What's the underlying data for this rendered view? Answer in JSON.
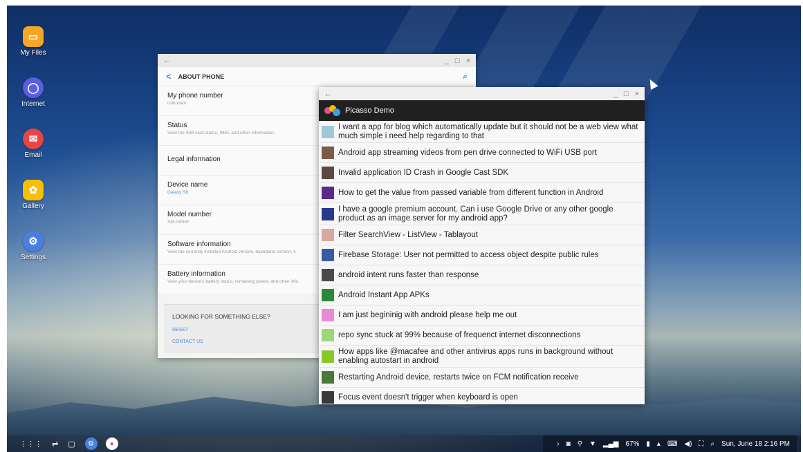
{
  "desktop": {
    "icons": [
      {
        "label": "My Files",
        "icon": "folder-icon",
        "color": "#f5a623",
        "glyph": "▭"
      },
      {
        "label": "Internet",
        "icon": "globe-icon",
        "color": "#5b5ee0",
        "glyph": "◯"
      },
      {
        "label": "Email",
        "icon": "mail-icon",
        "color": "#e84545",
        "glyph": "✉"
      },
      {
        "label": "Gallery",
        "icon": "flower-icon",
        "color": "#f5c000",
        "glyph": "✿"
      },
      {
        "label": "Settings",
        "icon": "gear-icon",
        "color": "#4a7fe0",
        "glyph": "⚙"
      }
    ]
  },
  "about_window": {
    "title_back": "←",
    "controls": [
      "_",
      "□",
      "×"
    ],
    "header": "ABOUT PHONE",
    "items": [
      {
        "title": "My phone number",
        "sub": "Unknown"
      },
      {
        "title": "Status",
        "sub": "View the SIM card status, IMEI, and other information."
      },
      {
        "title": "Legal information",
        "sub": ""
      },
      {
        "title": "Device name",
        "sub": "Galaxy S8"
      },
      {
        "title": "Model number",
        "sub": "SM-G950F"
      },
      {
        "title": "Software information",
        "sub": "View the currently installed Android version, baseband version, k"
      },
      {
        "title": "Battery information",
        "sub": "View your device's battery status, remaining power, and other info"
      }
    ],
    "looking": {
      "heading": "LOOKING FOR SOMETHING ELSE?",
      "links": [
        "RESET",
        "CONTACT US"
      ]
    }
  },
  "picasso_window": {
    "title_back": "←",
    "controls": [
      "_",
      "□",
      "×"
    ],
    "app_name": "Picasso Demo",
    "rows": [
      {
        "text": "I want a app for blog which automatically update but it should not be a web view what much simple i need help regarding to that",
        "thumb": "#9fc8d8"
      },
      {
        "text": "Android app streaming videos from pen drive connected to WiFi USB port",
        "thumb": "#7a5c48"
      },
      {
        "text": "Invalid application ID Crash in Google Cast SDK",
        "thumb": "#5a4a40"
      },
      {
        "text": "How to get the value from passed variable from different function in Android",
        "thumb": "#5a2a8a"
      },
      {
        "text": "I have a google premium account. Can i use Google Drive or any other google product as an image server for my android app?",
        "thumb": "#2a3a8a"
      },
      {
        "text": "Filter SearchView - ListView - Tablayout",
        "thumb": "#d8a8a0"
      },
      {
        "text": "Firebase Storage: User not permitted to access object despite public rules",
        "thumb": "#3a5aa8"
      },
      {
        "text": "android intent runs faster than response",
        "thumb": "#4a4a4a"
      },
      {
        "text": "Android Instant App APKs",
        "thumb": "#2a8a3a"
      },
      {
        "text": "I am just begininig with android please help me out",
        "thumb": "#e88ad8"
      },
      {
        "text": "repo sync stuck at 99% because of frequenct internet disconnections",
        "thumb": "#9ad87a"
      },
      {
        "text": "How apps like @macafee and other antivirus apps runs in background without enabling autostart in android",
        "thumb": "#8ac82a"
      },
      {
        "text": "Restarting Android device, restarts twice on FCM notification receive",
        "thumb": "#4a7a3a"
      },
      {
        "text": "Focus event doesn't trigger when keyboard is open",
        "thumb": "#3a3a3a"
      }
    ]
  },
  "taskbar": {
    "left_buttons": [
      "⋮⋮⋮",
      "⇌",
      "▢"
    ],
    "status": {
      "battery": "67%",
      "datetime": "Sun, June 18 2:16 PM"
    }
  }
}
